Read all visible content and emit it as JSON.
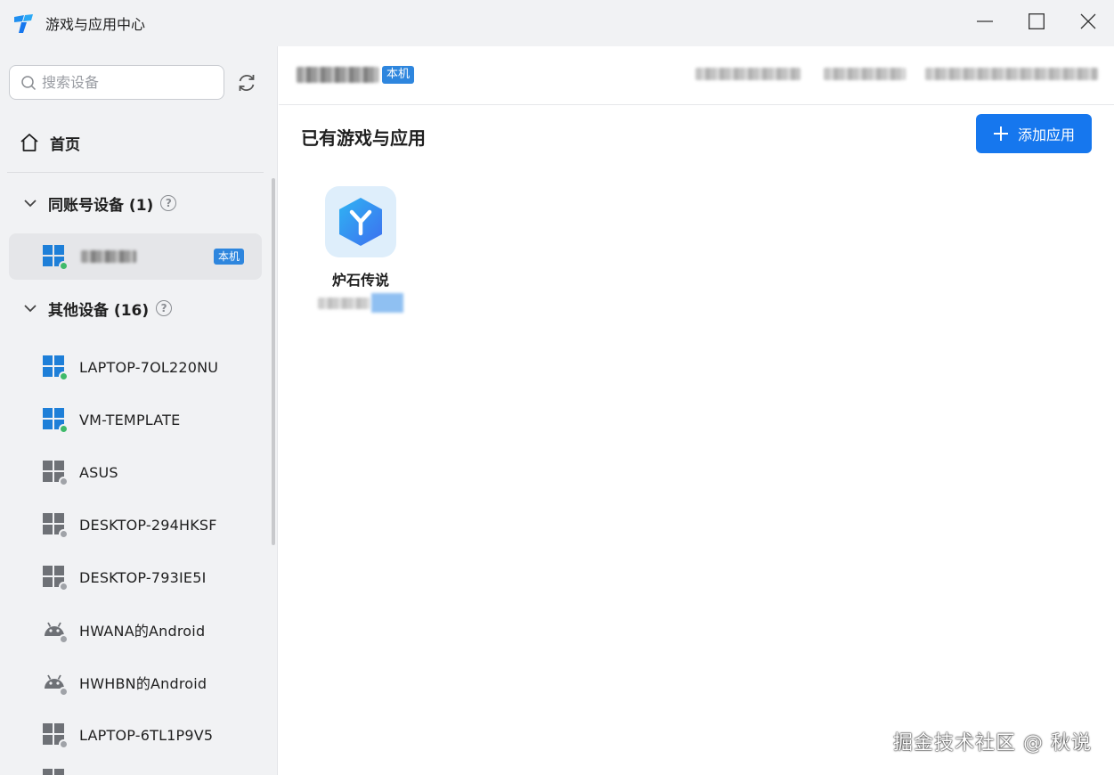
{
  "window": {
    "title": "游戏与应用中心"
  },
  "sidebar": {
    "search_placeholder": "搜索设备",
    "home_label": "首页",
    "same_account_group": "同账号设备 (1)",
    "other_group": "其他设备 (16)",
    "local_badge": "本机",
    "other_devices": [
      {
        "name": "LAPTOP-7OL220NU",
        "type": "windows",
        "online": true
      },
      {
        "name": "VM-TEMPLATE",
        "type": "windows",
        "online": true
      },
      {
        "name": "ASUS",
        "type": "windows",
        "online": false
      },
      {
        "name": "DESKTOP-294HKSF",
        "type": "windows",
        "online": false
      },
      {
        "name": "DESKTOP-793IE5I",
        "type": "windows",
        "online": false
      },
      {
        "name": "HWANA的Android",
        "type": "android",
        "online": false
      },
      {
        "name": "HWHBN的Android",
        "type": "android",
        "online": false
      },
      {
        "name": "LAPTOP-6TL1P9V5",
        "type": "windows",
        "online": false
      }
    ]
  },
  "header": {
    "local_badge": "本机"
  },
  "main": {
    "section_title": "已有游戏与应用",
    "add_button": "添加应用",
    "apps": [
      {
        "name": "炉石传说",
        "icon": "hearthstone-y-icon"
      }
    ]
  },
  "watermark": "掘金技术社区 @ 秋说",
  "colors": {
    "accent": "#1677ee",
    "badge": "#2e86de",
    "online": "#3fba6a",
    "offline": "#a0a3a8",
    "windows_blue": "#1e7fd8",
    "windows_gray": "#6e7176",
    "sidebar_bg": "#f1f2f4"
  }
}
